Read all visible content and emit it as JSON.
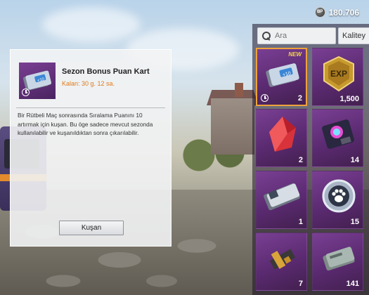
{
  "currency": {
    "icon": "bp-coin-icon",
    "icon_label": "BP",
    "value": "180.706"
  },
  "search": {
    "placeholder": "Ara"
  },
  "filter": {
    "label": "Kalitey"
  },
  "detail": {
    "title": "Sezon Bonus Puan Kart",
    "remaining": "Kalan: 30 g. 12 sa.",
    "description": "Bir Rütbeli Maç sonrasında Sıralama Puanını 10 artırmak için kuşan. Bu öge sadece mevcut sezonda kullanılabilir ve kuşanıldıktan sonra çıkarılabilir.",
    "button": "Kuşan"
  },
  "inventory": {
    "items": [
      {
        "name": "season-bonus-point-card",
        "icon": "bonus-card-icon",
        "badge": "NEW",
        "count": "2",
        "timed": true,
        "selected": true
      },
      {
        "name": "exp-card",
        "icon": "exp-badge-icon",
        "count": "1,500"
      },
      {
        "name": "red-crystal",
        "icon": "red-crystal-icon",
        "count": "2"
      },
      {
        "name": "color-card",
        "icon": "color-card-icon",
        "count": "14"
      },
      {
        "name": "ticket",
        "icon": "ticket-icon",
        "count": "1"
      },
      {
        "name": "paw-coin",
        "icon": "paw-coin-icon",
        "count": "15"
      },
      {
        "name": "upgrade-kit",
        "icon": "upgrade-kit-icon",
        "count": "7"
      },
      {
        "name": "voucher",
        "icon": "voucher-icon",
        "count": "141"
      }
    ]
  },
  "colors": {
    "accent": "#f0a23b",
    "timer": "#e07a1b",
    "item_bg": "#6a3384"
  }
}
